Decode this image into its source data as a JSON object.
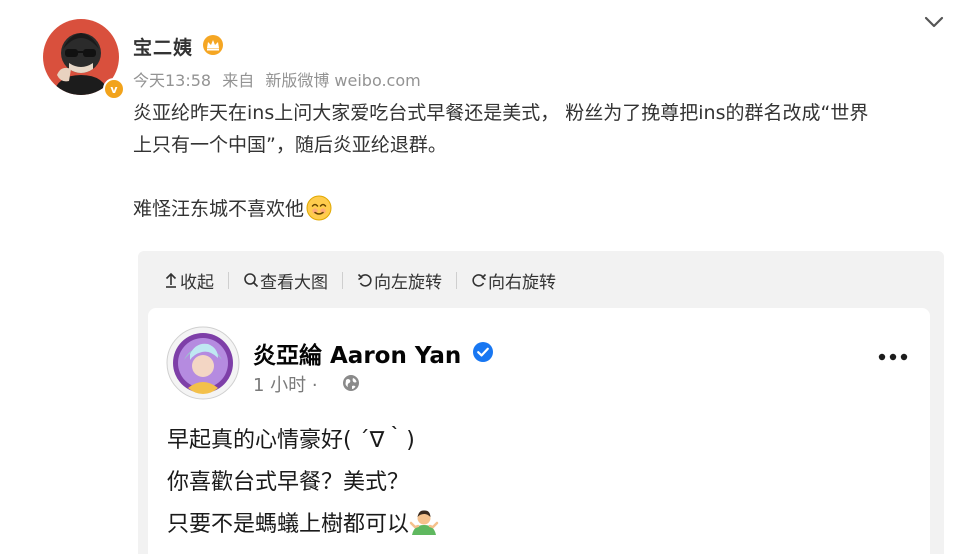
{
  "post": {
    "author": "宝二姨",
    "time": "今天13:58",
    "source_prefix": "来自",
    "source": "新版微博 weibo.com",
    "content_line1": "炎亚纶昨天在ins上问大家爱吃台式早餐还是美式， 粉丝为了挽尊把ins的群名改成“世界",
    "content_line2": "上只有一个中国”，随后炎亚纶退群。",
    "content_line3": "难怪汪东城不喜欢他",
    "verified_badge": "v",
    "icons": [
      "crown-icon",
      "chevron-down-icon",
      "smile-emoji-icon",
      "verified-badge-icon"
    ]
  },
  "toolbar": {
    "collapse": "收起",
    "view_large": "查看大图",
    "rotate_left": "向左旋转",
    "rotate_right": "向右旋转"
  },
  "embedded_post": {
    "name": "炎亞綸 Aaron Yan",
    "time": "1 小时 ·",
    "line1": "早起真的心情豪好( ´∇｀)",
    "line2": "你喜歡台式早餐？美式？",
    "line3": "只要不是螞蟻上樹都可以",
    "icons": [
      "verified-check-icon",
      "globe-icon",
      "more-options-icon",
      "shrug-emoji-icon"
    ]
  },
  "colors": {
    "meta_gray": "#939393",
    "panel_bg": "#f2f2f2",
    "fb_verified_blue": "#1877f2",
    "weibo_badge_orange": "#f2a31b"
  }
}
